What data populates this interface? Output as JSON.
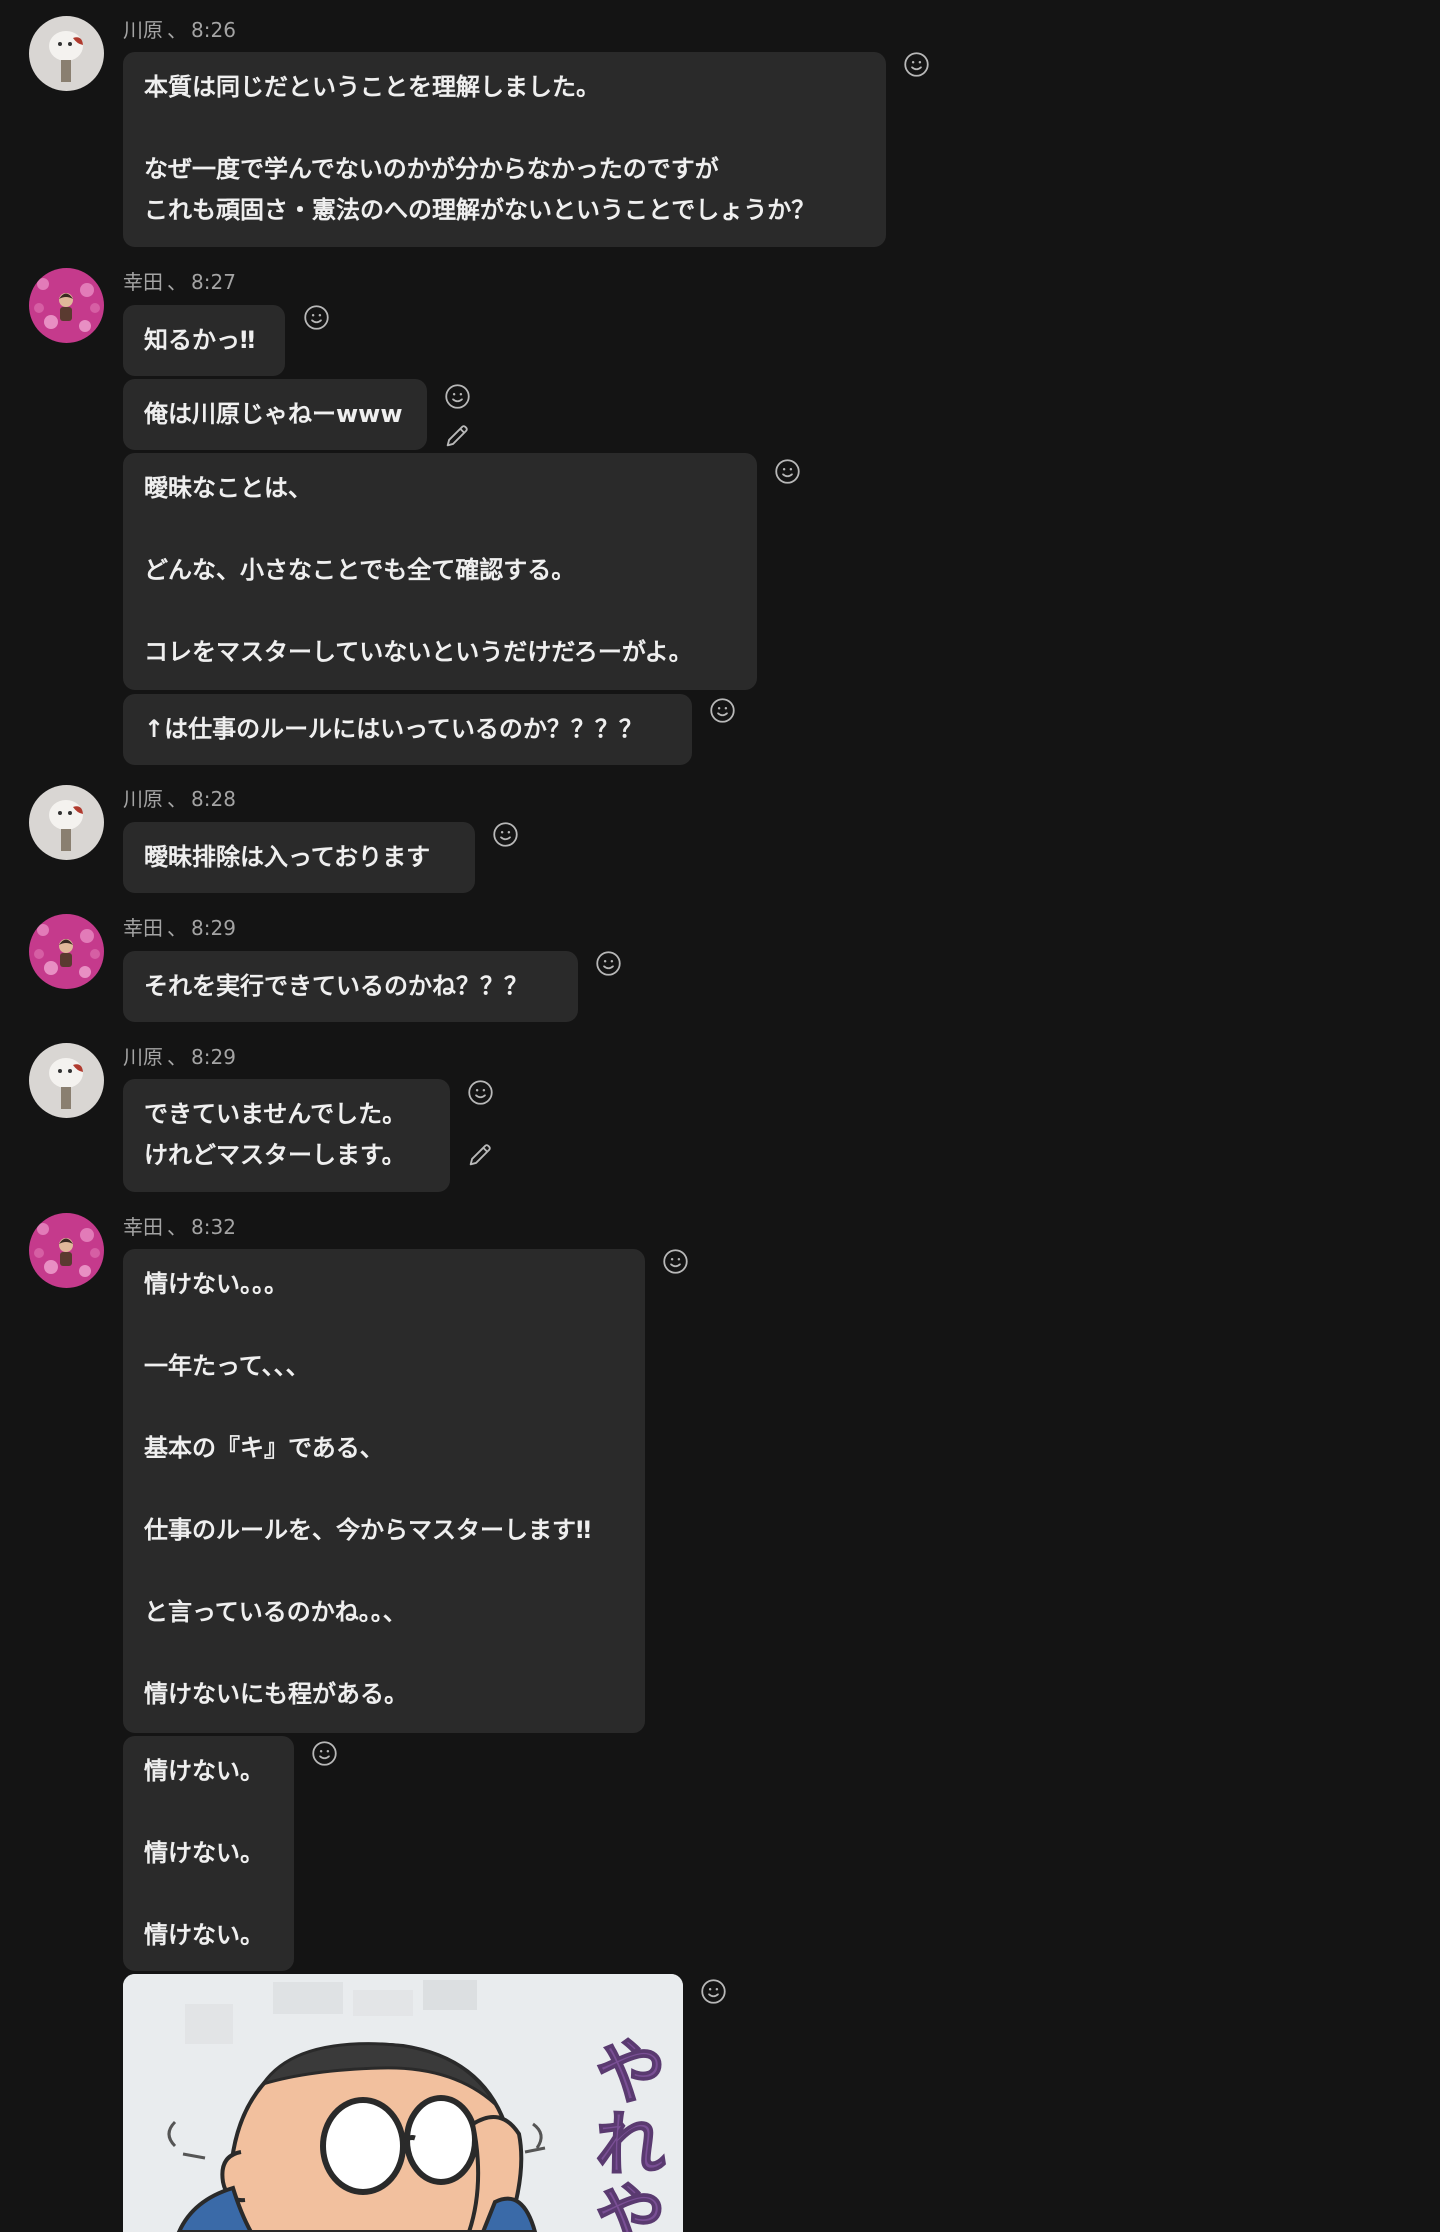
{
  "messages": [
    {
      "sender": "川原",
      "time": "8:26",
      "avatar": "kawahara",
      "bubbles": [
        {
          "lines": [
            "本質は同じだということを理解しました。",
            "",
            "なぜ一度で学んでないのかが分からなかったのですが",
            "これも頑固さ・憲法のへの理解がないということでしょうか？"
          ]
        }
      ]
    },
    {
      "sender": "幸田",
      "time": "8:27",
      "avatar": "koda",
      "bubbles": [
        {
          "lines": [
            "知るかっ‼"
          ]
        },
        {
          "lines": [
            "俺は川原じゃねーwww"
          ],
          "edited": true
        },
        {
          "lines": [
            "曖昧なことは、",
            "",
            "どんな、小さなことでも全て確認する。",
            "",
            "コレをマスターしていないというだけだろーがよ。"
          ]
        },
        {
          "lines": [
            "↑は仕事のルールにはいっているのか？？？？"
          ]
        }
      ]
    },
    {
      "sender": "川原",
      "time": "8:28",
      "avatar": "kawahara",
      "bubbles": [
        {
          "lines": [
            "曖昧排除は入っております"
          ]
        }
      ]
    },
    {
      "sender": "幸田",
      "time": "8:29",
      "avatar": "koda",
      "bubbles": [
        {
          "lines": [
            "それを実行できているのかね？？？"
          ]
        }
      ]
    },
    {
      "sender": "川原",
      "time": "8:29",
      "avatar": "kawahara",
      "bubbles": [
        {
          "lines": [
            "できていませんでした。",
            "けれどマスターします。"
          ],
          "edited": true
        }
      ]
    },
    {
      "sender": "幸田",
      "time": "8:32",
      "avatar": "koda",
      "bubbles": [
        {
          "lines": [
            "情けない。。。",
            "",
            "一年たって、、、",
            "",
            "基本の『キ』である、",
            "",
            "仕事のルールを、今からマスターします‼",
            "",
            "と言っているのかね。。、",
            "",
            "情けないにも程がある。"
          ]
        },
        {
          "lines": [
            "情けない。",
            "",
            "情けない。",
            "",
            "情けない。"
          ]
        },
        {
          "image": "sticker",
          "sticker_text": "やれや"
        }
      ]
    }
  ],
  "icons": {
    "reaction": "smiley-icon",
    "edit": "pencil-icon"
  },
  "colors": {
    "background": "#141414",
    "bubble": "#2a2a2a",
    "meta": "#a4a4a4",
    "text": "#efefef",
    "sticker_text": "#7a4f95"
  }
}
